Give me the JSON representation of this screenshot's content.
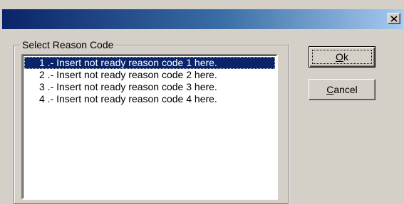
{
  "window": {
    "title": "",
    "close_icon": "close-icon"
  },
  "group": {
    "label": "Select Reason Code"
  },
  "list": {
    "items": [
      "1 .- Insert not ready reason code 1 here.",
      "2 .- Insert not ready reason code 2 here.",
      "3 .- Insert not ready reason code 3 here.",
      "4 .- Insert not ready reason code 4 here."
    ],
    "selected": "1 .- Insert not ready reason code 1 here."
  },
  "buttons": {
    "ok": {
      "mnemonic": "O",
      "rest": "k"
    },
    "cancel": {
      "mnemonic": "C",
      "rest": "ancel"
    }
  },
  "colors": {
    "title_gradient_start": "#0a246a",
    "title_gradient_end": "#a6caf0",
    "selection": "#0a246a",
    "face": "#d4d0c8"
  }
}
